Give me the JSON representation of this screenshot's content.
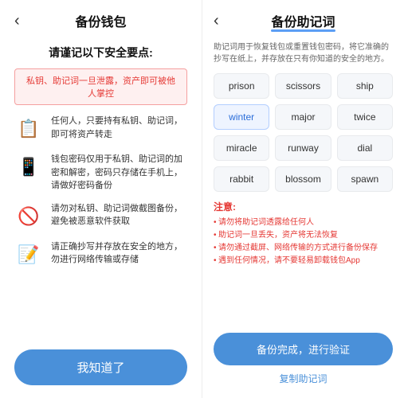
{
  "left": {
    "back_arrow": "‹",
    "title": "备份钱包",
    "section_heading": "请谨记以下安全要点:",
    "warning_banner": "私钥、助记词一旦泄露，资产即可被他人掌控",
    "items": [
      {
        "icon": "📋",
        "text": "任何人，只要持有私钥、助记词，即可将资产转走"
      },
      {
        "icon": "📱",
        "text": "钱包密码仅用于私钥、助记词的加密和解密，密码只存储在手机上，请做好密码备份"
      },
      {
        "icon": "🚫",
        "text": "请勿对私钥、助记词做截图备份，避免被恶意软件获取"
      },
      {
        "icon": "📝",
        "text": "请正确抄写并存放在安全的地方，勿进行网络传输或存储"
      }
    ],
    "confirm_button": "我知道了"
  },
  "right": {
    "back_arrow": "‹",
    "title": "备份助记词",
    "desc": "助记词用于恢复钱包或重置钱包密码，将它准确的抄写在纸上，并存放在只有你知道的安全的地方。",
    "words": [
      {
        "text": "prison",
        "highlighted": false
      },
      {
        "text": "scissors",
        "highlighted": false
      },
      {
        "text": "ship",
        "highlighted": false
      },
      {
        "text": "winter",
        "highlighted": true
      },
      {
        "text": "major",
        "highlighted": false
      },
      {
        "text": "twice",
        "highlighted": false
      },
      {
        "text": "miracle",
        "highlighted": false
      },
      {
        "text": "runway",
        "highlighted": false
      },
      {
        "text": "dial",
        "highlighted": false
      },
      {
        "text": "rabbit",
        "highlighted": false
      },
      {
        "text": "blossom",
        "highlighted": false
      },
      {
        "text": "spawn",
        "highlighted": false
      }
    ],
    "notes_title": "注意:",
    "notes": [
      "请勿将助记词透露给任何人",
      "助记词一旦丢失，资产将无法恢复",
      "请勿通过截屏、网络传输的方式进行备份保存",
      "遇到任何情况，请不要轻易卸载钱包App"
    ],
    "verify_button": "备份完成，进行验证",
    "copy_link": "复制助记词"
  }
}
